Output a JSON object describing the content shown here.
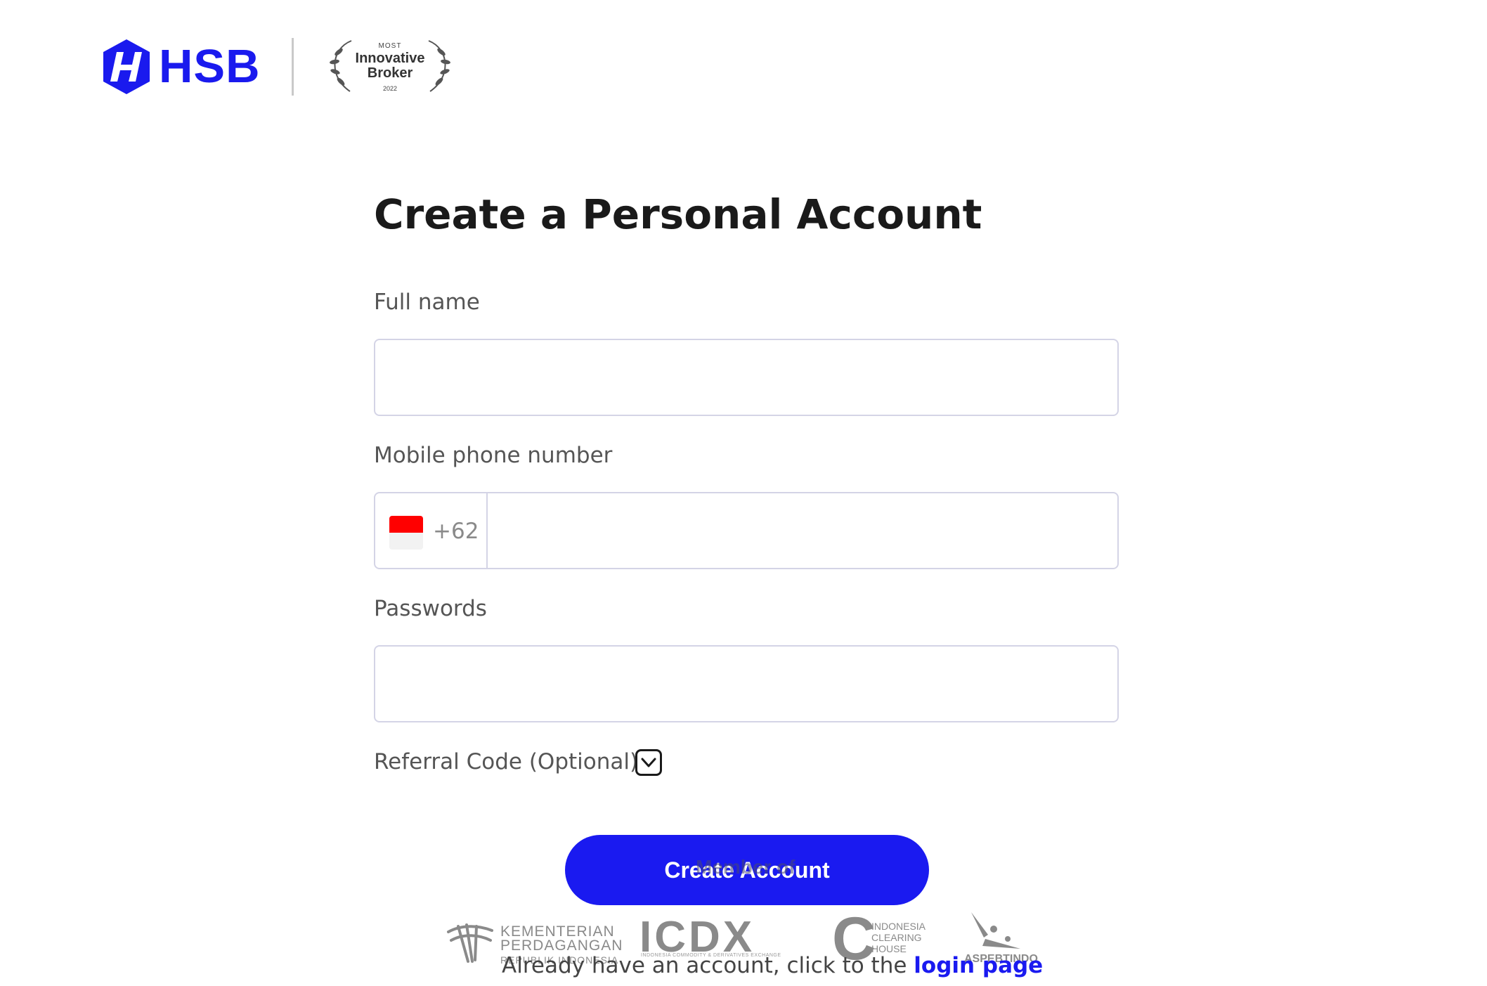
{
  "brand": {
    "name": "HSB",
    "color": "#1a1aee"
  },
  "award": {
    "top": "MOST",
    "line1": "Innovative",
    "line2": "Broker",
    "year": "2022"
  },
  "page": {
    "title": "Create a Personal Account"
  },
  "form": {
    "full_name": {
      "label": "Full name",
      "value": "",
      "placeholder": ""
    },
    "phone": {
      "label": "Mobile phone number",
      "country_code": "+62",
      "flag_icon": "indonesia-flag-icon",
      "value": "",
      "placeholder": ""
    },
    "password": {
      "label": "Passwords",
      "value": "",
      "placeholder": ""
    },
    "referral": {
      "label": "Referral Code (Optional)",
      "toggle_icon": "chevron-down-icon",
      "expanded": false
    },
    "submit_label": "Create Account"
  },
  "members": {
    "heading": "Member of",
    "kemendag": {
      "line1": "KEMENTERIAN",
      "line2": "PERDAGANGAN",
      "line3": "REPUBLIK INDONESIA"
    },
    "icdx": {
      "name": "ICDX",
      "sub": "INDONESIA COMMODITY & DERIVATIVES EXCHANGE"
    },
    "ich": {
      "letter": "C",
      "line1": "INDONESIA",
      "line2": "CLEARING",
      "line3": "HOUSE"
    },
    "aspebtindo": {
      "name": "ASPEBTINDO"
    }
  },
  "footer": {
    "prefix": "Already have an account, click to the",
    "link": "login page"
  },
  "colors": {
    "accent": "#1a1af0",
    "flag_red": "#ff0000"
  }
}
